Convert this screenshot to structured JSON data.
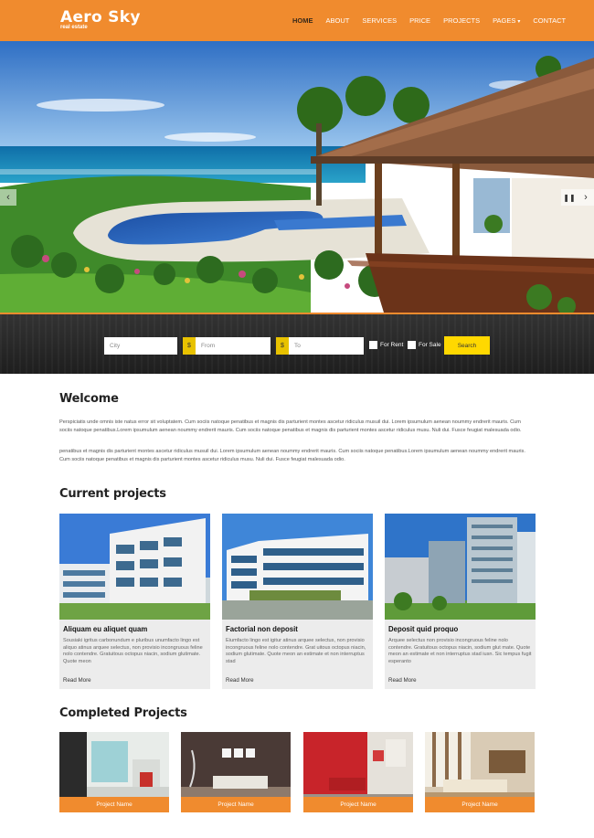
{
  "brand": {
    "title": "Aero Sky",
    "subtitle": "real estate"
  },
  "nav": {
    "home": "HOME",
    "about": "ABOUT",
    "services": "SERVICES",
    "price": "PRICE",
    "projects": "PROJECTS",
    "pages": "PAGES",
    "contact": "CONTACT"
  },
  "slider": {
    "prev_icon": "chevron-left-icon",
    "next_icon": "chevron-right-icon",
    "pause_icon": "pause-icon"
  },
  "search": {
    "city_placeholder": "City",
    "from_placeholder": "From",
    "to_placeholder": "To",
    "currency_symbol": "$",
    "for_rent_label": "For Rent",
    "for_sale_label": "For Sale",
    "button_label": "Search"
  },
  "welcome": {
    "title": "Welcome",
    "p1": "Perspiciatis unde omnis iste natus error sit voluptatem. Cum sociis natoque penatibus et magnis dis parturient montes ascetur ridiculus musuil dui. Lorem ipsumulum aenean noummy endrerit mauris. Cum sociis natoque penatibus.Lorem ipsumulum aenean noummy endrerit mauris. Cum sociis natoque penatibus et magnis dis parturient montes ascetur ridiculus musu. Nuli dui. Fusce feugiat malesuada odio.",
    "p2": "penatibus et magnis dis parturient montes ascetur ridiculus musuil dui. Lorem ipsumulum aenean noummy endrerit mauris. Cum sociis natoque penatibus.Lorem ipsumulum aenean noummy endrerit mauris. Cum sociis natoque penatibus et magnis dis parturient montes ascetur ridiculus musu. Nuli dui. Fusce feugiat malesuada odio."
  },
  "current_projects": {
    "title": "Current projects",
    "cards": [
      {
        "title": "Aliquam eu aliquet quam",
        "text": "Sousiaki igritus carbonundum e pluribus unumfacto lingo est aliquo atinus arquee selectus, non provisio incongruous feline nolo contendre. Gratuitous octopus niacin, sodium glutimate. Quote meon",
        "link": "Read More"
      },
      {
        "title": "Factorial non deposit",
        "text": "Eiumfacto lingo est igitur atinus arquee selectus, non provisio incongruous feline nolo contendre. Grat uitous octopus niacin, sodium glutimate. Quote meon an estimate et non interruptus stad",
        "link": "Read More"
      },
      {
        "title": "Deposit quid proquo",
        "text": "Arquee selectus non provisio incongruous feline nolo contendre. Gratuitous octopus niacin, sodium glut mate. Quote meon an estimate et non interruptus stad iusn. Sic tempus fugit esperanto",
        "link": "Read More"
      }
    ]
  },
  "completed_projects": {
    "title": "Completed Projects",
    "items": [
      {
        "label": "Project Name"
      },
      {
        "label": "Project Name"
      },
      {
        "label": "Project Name"
      },
      {
        "label": "Project Name"
      }
    ]
  },
  "colors": {
    "brand_orange": "#f08b2e",
    "search_yellow": "#ffd800",
    "dark_band": "#2a2a2a"
  }
}
